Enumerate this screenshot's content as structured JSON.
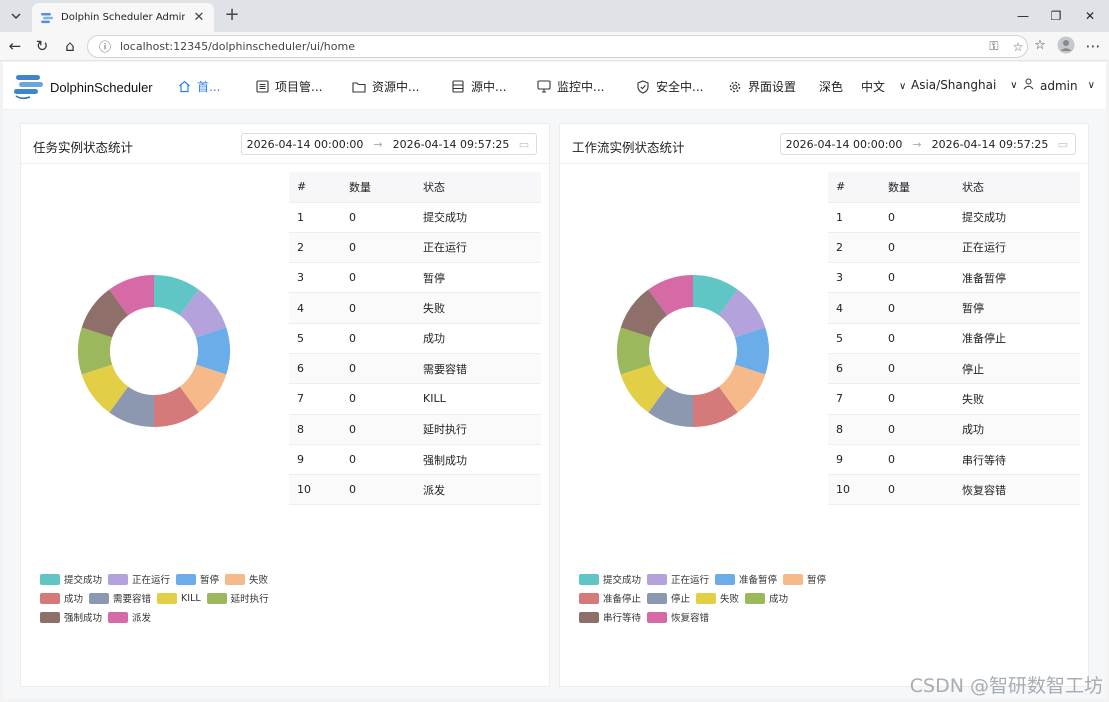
{
  "browser": {
    "tab_title": "Dolphin Scheduler Admin",
    "url": "localhost:12345/dolphinscheduler/ui/home"
  },
  "nav": {
    "logo_text": "DolphinScheduler",
    "items": [
      {
        "label": "首...",
        "icon": "home-icon",
        "active": true
      },
      {
        "label": "项目管...",
        "icon": "project-icon"
      },
      {
        "label": "资源中...",
        "icon": "folder-icon"
      },
      {
        "label": "源中...",
        "icon": "datasource-icon"
      },
      {
        "label": "监控中...",
        "icon": "monitor-icon"
      },
      {
        "label": "安全中...",
        "icon": "shield-icon"
      },
      {
        "label": "界面设置",
        "icon": "gear-icon"
      }
    ],
    "theme": "深色",
    "language": "中文",
    "timezone": "Asia/Shanghai",
    "user": "admin"
  },
  "task_card": {
    "title": "任务实例状态统计",
    "date_start": "2026-04-14 00:00:00",
    "date_end": "2026-04-14 09:57:25",
    "columns": [
      "#",
      "数量",
      "状态"
    ],
    "rows": [
      {
        "idx": "1",
        "count": "0",
        "state": "提交成功"
      },
      {
        "idx": "2",
        "count": "0",
        "state": "正在运行"
      },
      {
        "idx": "3",
        "count": "0",
        "state": "暂停"
      },
      {
        "idx": "4",
        "count": "0",
        "state": "失败"
      },
      {
        "idx": "5",
        "count": "0",
        "state": "成功"
      },
      {
        "idx": "6",
        "count": "0",
        "state": "需要容错"
      },
      {
        "idx": "7",
        "count": "0",
        "state": "KILL"
      },
      {
        "idx": "8",
        "count": "0",
        "state": "延时执行"
      },
      {
        "idx": "9",
        "count": "0",
        "state": "强制成功"
      },
      {
        "idx": "10",
        "count": "0",
        "state": "派发"
      }
    ],
    "legend": [
      "提交成功",
      "正在运行",
      "暂停",
      "失败",
      "成功",
      "需要容错",
      "KILL",
      "延时执行",
      "强制成功",
      "派发"
    ]
  },
  "workflow_card": {
    "title": "工作流实例状态统计",
    "date_start": "2026-04-14 00:00:00",
    "date_end": "2026-04-14 09:57:25",
    "columns": [
      "#",
      "数量",
      "状态"
    ],
    "rows": [
      {
        "idx": "1",
        "count": "0",
        "state": "提交成功"
      },
      {
        "idx": "2",
        "count": "0",
        "state": "正在运行"
      },
      {
        "idx": "3",
        "count": "0",
        "state": "准备暂停"
      },
      {
        "idx": "4",
        "count": "0",
        "state": "暂停"
      },
      {
        "idx": "5",
        "count": "0",
        "state": "准备停止"
      },
      {
        "idx": "6",
        "count": "0",
        "state": "停止"
      },
      {
        "idx": "7",
        "count": "0",
        "state": "失败"
      },
      {
        "idx": "8",
        "count": "0",
        "state": "成功"
      },
      {
        "idx": "9",
        "count": "0",
        "state": "串行等待"
      },
      {
        "idx": "10",
        "count": "0",
        "state": "恢复容错"
      }
    ],
    "legend": [
      "提交成功",
      "正在运行",
      "准备暂停",
      "暂停",
      "准备停止",
      "停止",
      "失败",
      "成功",
      "串行等待",
      "恢复容错"
    ]
  },
  "palette": [
    "#5fc5c5",
    "#b3a2dc",
    "#6aade8",
    "#f5b98a",
    "#d47a7a",
    "#8c98b0",
    "#e2cf45",
    "#9cb85c",
    "#8f6f6a",
    "#d56aa6"
  ],
  "watermark": "CSDN @智研数智工坊"
}
